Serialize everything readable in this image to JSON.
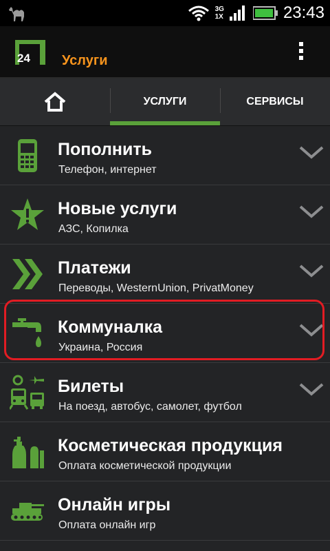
{
  "status_bar": {
    "time": "23:43",
    "network_top": "3G",
    "network_bottom": "1X"
  },
  "app_bar": {
    "logo_text": "24",
    "title": "Услуги"
  },
  "tabs": [
    {
      "label": "",
      "icon": "home-icon"
    },
    {
      "label": "УСЛУГИ",
      "selected": true
    },
    {
      "label": "СЕРВИСЫ"
    }
  ],
  "items": [
    {
      "title": "Пополнить",
      "subtitle": "Телефон, интернет",
      "icon": "phone-icon",
      "has_chevron": true
    },
    {
      "title": "Новые услуги",
      "subtitle": "АЗС, Копилка",
      "icon": "star-icon",
      "has_chevron": true
    },
    {
      "title": "Платежи",
      "subtitle": "Переводы, WesternUnion, PrivatMoney",
      "icon": "chevrons-icon",
      "has_chevron": true
    },
    {
      "title": "Коммуналка",
      "subtitle": "Украина, Россия",
      "icon": "faucet-icon",
      "has_chevron": true,
      "highlighted": true
    },
    {
      "title": "Билеты",
      "subtitle": "На поезд, автобус, самолет, футбол",
      "icon": "transport-icon",
      "has_chevron": true
    },
    {
      "title": "Косметическая продукция",
      "subtitle": "Оплата косметической продукции",
      "icon": "cosmetics-icon",
      "has_chevron": false
    },
    {
      "title": "Онлайн игры",
      "subtitle": "Оплата онлайн игр",
      "icon": "tank-icon",
      "has_chevron": false
    }
  ],
  "colors": {
    "accent_orange": "#f7941d",
    "accent_green": "#5aa13a",
    "highlight_red": "#e21c23"
  }
}
